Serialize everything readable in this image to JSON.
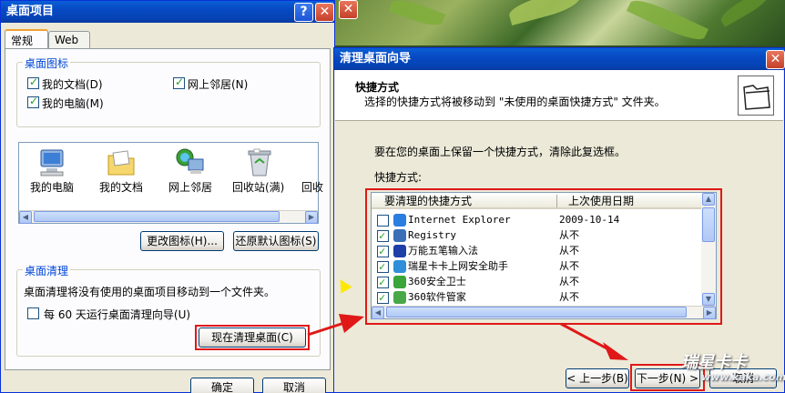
{
  "left_window": {
    "title": "桌面项目",
    "tabs": [
      "常规",
      "Web"
    ],
    "desktop_icons_group": "桌面图标",
    "checks": [
      {
        "label": "我的文档(D)",
        "checked": true
      },
      {
        "label": "网上邻居(N)",
        "checked": true
      },
      {
        "label": "我的电脑(M)",
        "checked": true
      }
    ],
    "icons": [
      "我的电脑",
      "我的文档",
      "网上邻居",
      "回收站(满)",
      "回收"
    ],
    "change_icon_button": "更改图标(H)...",
    "restore_default_button": "还原默认图标(S)",
    "cleanup_group": "桌面清理",
    "cleanup_desc": "桌面清理将没有使用的桌面项目移动到一个文件夹。",
    "run_every_label": "每 60 天运行桌面清理向导(U)",
    "run_every_checked": false,
    "clean_now_button": "现在清理桌面(C)",
    "ok_button": "确定",
    "cancel_button": "取消"
  },
  "wizard": {
    "title": "清理桌面向导",
    "header_title": "快捷方式",
    "header_desc": "选择的快捷方式将被移动到 \"未使用的桌面快捷方式\" 文件夹。",
    "instruction": "要在您的桌面上保留一个快捷方式，清除此复选框。",
    "shortcuts_label": "快捷方式:",
    "columns": [
      "要清理的快捷方式",
      "上次使用日期"
    ],
    "rows": [
      {
        "name": "Internet Explorer",
        "date": "2009-10-14",
        "checked": false,
        "icon_color": "#2a7de1"
      },
      {
        "name": "Registry",
        "date": "从不",
        "checked": true,
        "icon_color": "#3a6fb8"
      },
      {
        "name": "万能五笔输入法",
        "date": "从不",
        "checked": true,
        "icon_color": "#1f3fa8"
      },
      {
        "name": "瑞星卡卡上网安全助手",
        "date": "从不",
        "checked": true,
        "icon_color": "#2f8fd8"
      },
      {
        "name": "360安全卫士",
        "date": "从不",
        "checked": true,
        "icon_color": "#3aa53a"
      },
      {
        "name": "360软件管家",
        "date": "从不",
        "checked": true,
        "icon_color": "#48a848"
      }
    ],
    "back_button": "< 上一步(B)",
    "next_button": "下一步(N) >",
    "cancel_button": "取消"
  },
  "watermark": {
    "brand": "瑞星卡卡",
    "url": "www.kaka.com"
  }
}
